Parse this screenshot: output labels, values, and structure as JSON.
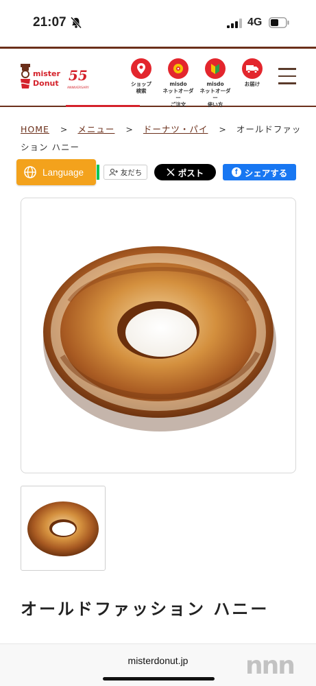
{
  "status_bar": {
    "time": "21:07",
    "network": "4G",
    "icons": [
      "bell-slash-icon",
      "signal-icon",
      "battery-icon"
    ]
  },
  "header": {
    "logo_text_line1": "mister",
    "logo_text_line2": "Donut",
    "anniversary": "55",
    "anniversary_sub": "ANNIVERSARY",
    "nav": [
      {
        "label": "ショップ\n検索",
        "icon": "map-pin-icon"
      },
      {
        "label": "misdo\nネットオーダー\nご注文",
        "icon": "order-icon"
      },
      {
        "label": "misdo\nネットオーダー\n使い方",
        "icon": "beginner-icon"
      },
      {
        "label": "お届け",
        "icon": "delivery-truck-icon"
      }
    ],
    "menu_icon": "hamburger-menu-icon"
  },
  "breadcrumb": {
    "items": [
      "HOME",
      "メニュー",
      "ドーナツ・パイ"
    ],
    "separator": ">",
    "current": "オールドファッション ハニー"
  },
  "share": {
    "language_label": "Language",
    "line_label": "友だち",
    "x_label": "ポスト",
    "facebook_label": "シェアする"
  },
  "product": {
    "name": "オールドファッション ハニー"
  },
  "browser": {
    "url": "misterdonut.jp"
  },
  "watermark": "nnn",
  "colors": {
    "brand_brown": "#6b2f1a",
    "brand_red": "#e3262d",
    "language_orange": "#f3a21c",
    "facebook_blue": "#1877f2",
    "line_green": "#06c755"
  }
}
